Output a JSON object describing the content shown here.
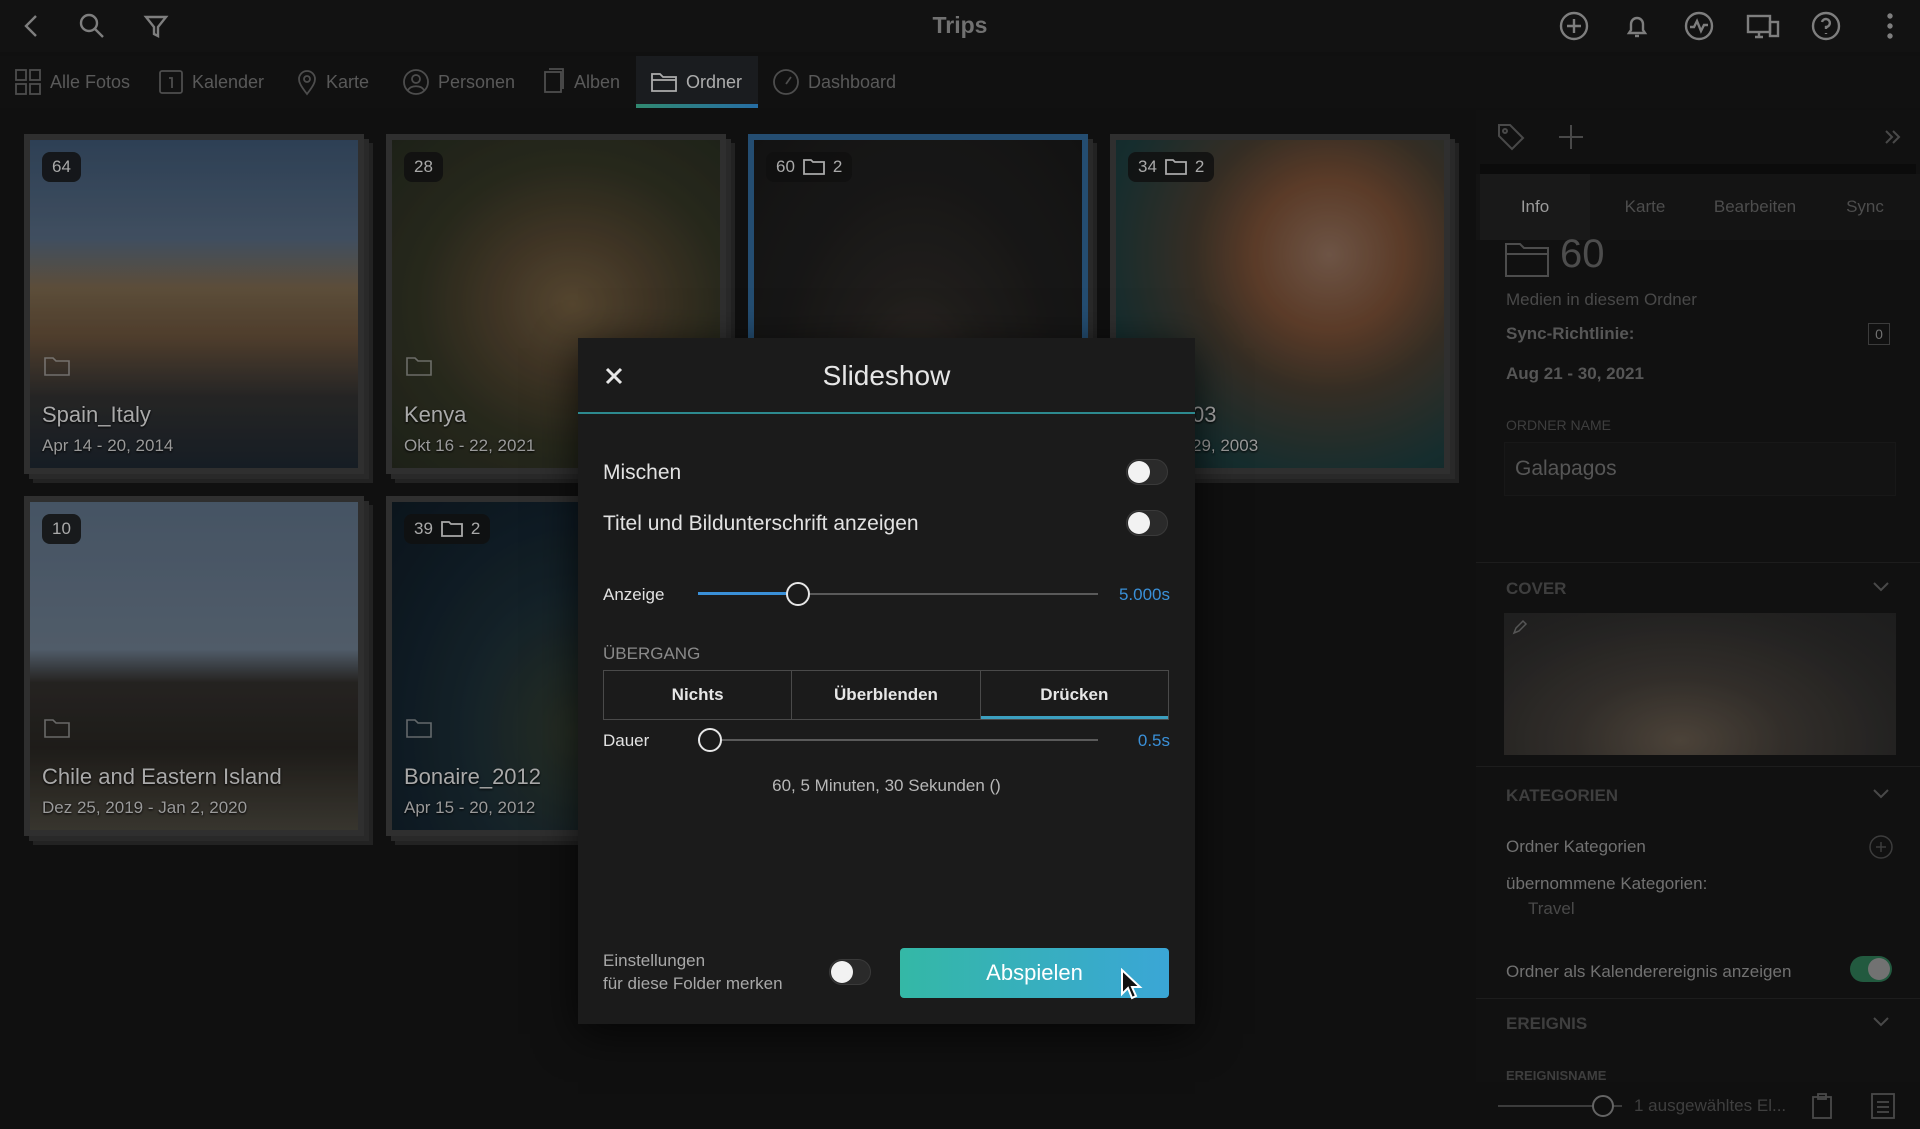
{
  "app": {
    "title": "Trips"
  },
  "nav": {
    "tabs": [
      {
        "label": "Alle Fotos"
      },
      {
        "label": "Kalender"
      },
      {
        "label": "Karte"
      },
      {
        "label": "Personen"
      },
      {
        "label": "Alben"
      },
      {
        "label": "Ordner"
      },
      {
        "label": "Dashboard"
      }
    ],
    "active_tab": "Ordner"
  },
  "folders": [
    {
      "count": "64",
      "subfolders": "",
      "name": "Spain_Italy",
      "date": "Apr 14 - 20, 2014"
    },
    {
      "count": "28",
      "subfolders": "",
      "name": "Kenya",
      "date": "Okt 16 - 22, 2021"
    },
    {
      "count": "60",
      "subfolders": "2",
      "name": "",
      "date": ""
    },
    {
      "count": "34",
      "subfolders": "2",
      "name": "03",
      "date": "29, 2003"
    },
    {
      "count": "10",
      "subfolders": "",
      "name": "Chile and Eastern Island",
      "date": "Dez 25, 2019 - Jan 2, 2020"
    },
    {
      "count": "39",
      "subfolders": "2",
      "name": "Bonaire_2012",
      "date": "Apr 15 - 20, 2012"
    }
  ],
  "panel": {
    "tabs": [
      "Info",
      "Karte",
      "Bearbeiten",
      "Sync"
    ],
    "media_count": "60",
    "media_label": "Medien in diesem Ordner",
    "sync_label": "Sync-Richtlinie:",
    "sync_value": "0",
    "date_range": "Aug 21 - 30, 2021",
    "folder_name_label": "ORDNER NAME",
    "folder_name_value": "Galapagos",
    "cover_label": "COVER",
    "categories_label": "KATEGORIEN",
    "folder_categories": "Ordner Kategorien",
    "inherited_label": "übernommene Kategorien:",
    "inherited_value": "Travel",
    "calendar_event_label": "Ordner als Kalenderereignis anzeigen",
    "event_label": "EREIGNIS",
    "event_name_label": "EREIGNISNAME",
    "selection_status": "1 ausgewähltes El..."
  },
  "modal": {
    "title": "Slideshow",
    "shuffle_label": "Mischen",
    "captions_label": "Titel und Bildunterschrift anzeigen",
    "display_label": "Anzeige",
    "display_value": "5.000s",
    "display_fraction": 0.25,
    "transition_label": "ÜBERGANG",
    "transitions": [
      "Nichts",
      "Überblenden",
      "Drücken"
    ],
    "active_transition": "Drücken",
    "duration_label": "Dauer",
    "duration_value": "0.5s",
    "duration_fraction": 0.03,
    "summary": "60, 5 Minuten, 30 Sekunden ()",
    "remember_label_line1": "Einstellungen",
    "remember_label_line2": "für diese Folder merken",
    "play_label": "Abspielen"
  },
  "colors": {
    "accent": "#3a90d8",
    "teal": "#34b8a6"
  }
}
